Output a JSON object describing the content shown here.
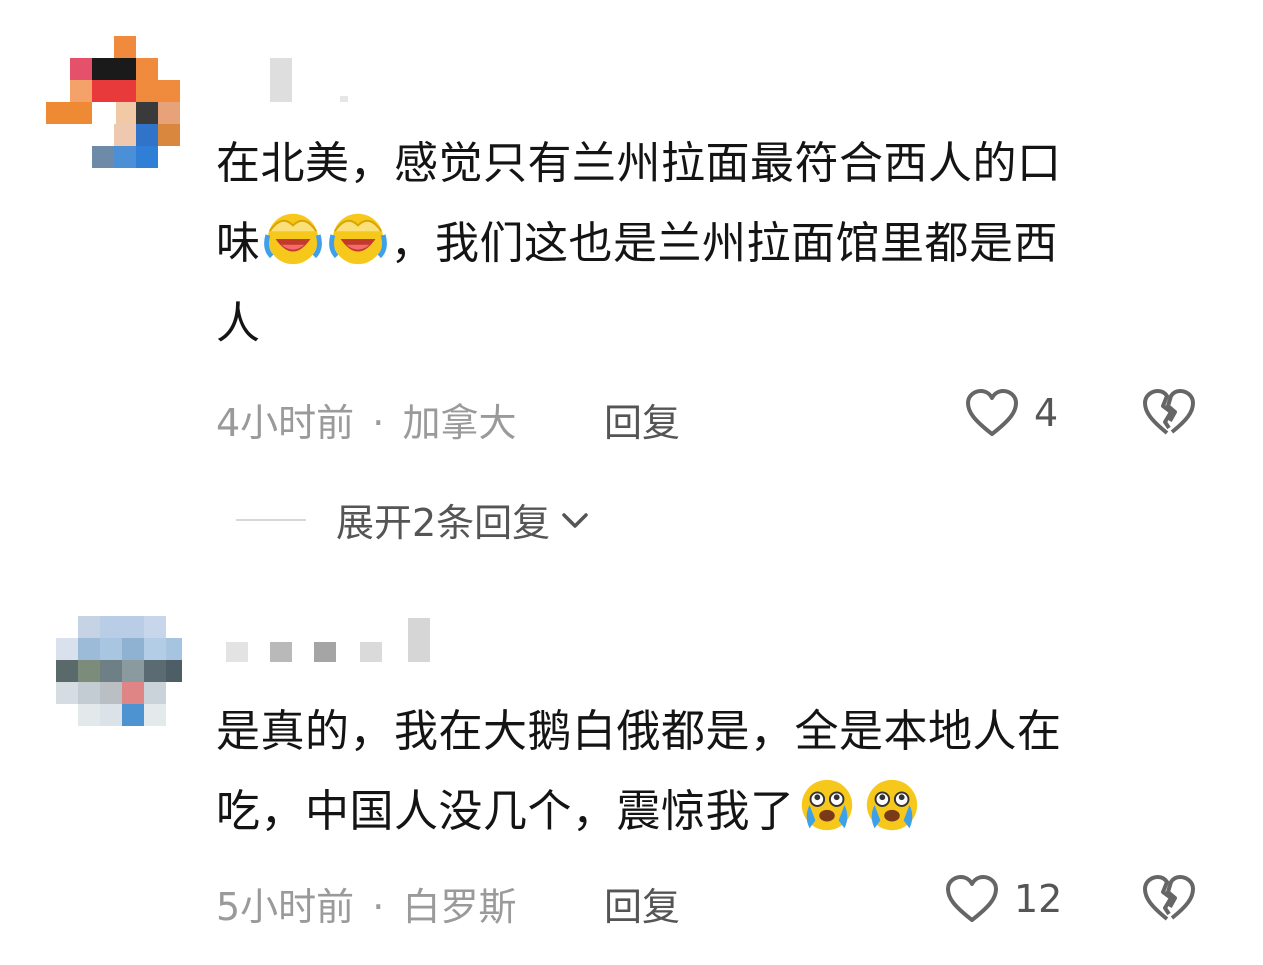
{
  "comments": [
    {
      "text_line1": "在北美，感觉只有兰州拉面最符合西人的口",
      "text_line2_pre": "味",
      "text_line2_post": "，我们这也是兰州拉面馆里都是西",
      "text_line3": "人",
      "emoji": "face-holding-back-tears-laughing-icon",
      "time": "4小时前",
      "separator": "·",
      "location": "加拿大",
      "reply": "回复",
      "likes": "4"
    },
    {
      "text_line1": "是真的，我在大鹅白俄都是，全是本地人在",
      "text_line2_pre": "吃，中国人没几个，震惊我了",
      "emoji": "crying-face-icon",
      "time": "5小时前",
      "separator": "·",
      "location": "白罗斯",
      "reply": "回复",
      "likes": "12"
    }
  ],
  "expand_replies": "展开2条回复",
  "colors": {
    "meta_gray": "#9a9a9a",
    "action_gray": "#555555",
    "emoji_yellow": "#f5c518",
    "tear_blue": "#3fa0ea"
  }
}
